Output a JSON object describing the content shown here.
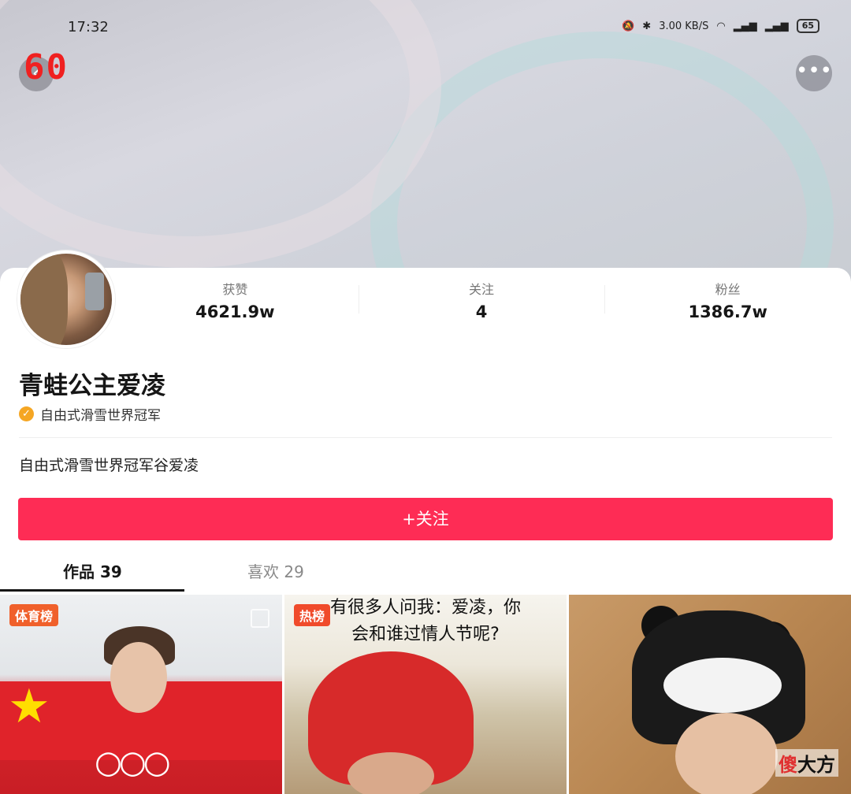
{
  "status_bar": {
    "time": "17:32",
    "net_speed": "3.00 KB/S",
    "battery": "65"
  },
  "app_logo": "60",
  "profile": {
    "stats": [
      {
        "label": "获赞",
        "value": "4621.9w"
      },
      {
        "label": "关注",
        "value": "4"
      },
      {
        "label": "粉丝",
        "value": "1386.7w"
      }
    ],
    "name": "青蛙公主爱凌",
    "verification": "自由式滑雪世界冠军",
    "bio": "自由式滑雪世界冠军谷爱凌",
    "follow_button": "+关注"
  },
  "tabs": [
    {
      "label": "作品 39"
    },
    {
      "label": "喜欢 29"
    }
  ],
  "videos": [
    {
      "badge": "体育榜"
    },
    {
      "badge": "热榜",
      "caption_line1": "有很多人问我：爱凌，你",
      "caption_line2": "会和谁过情人节呢?"
    },
    {}
  ],
  "watermark": {
    "part1": "傻",
    "part2": "大方"
  }
}
